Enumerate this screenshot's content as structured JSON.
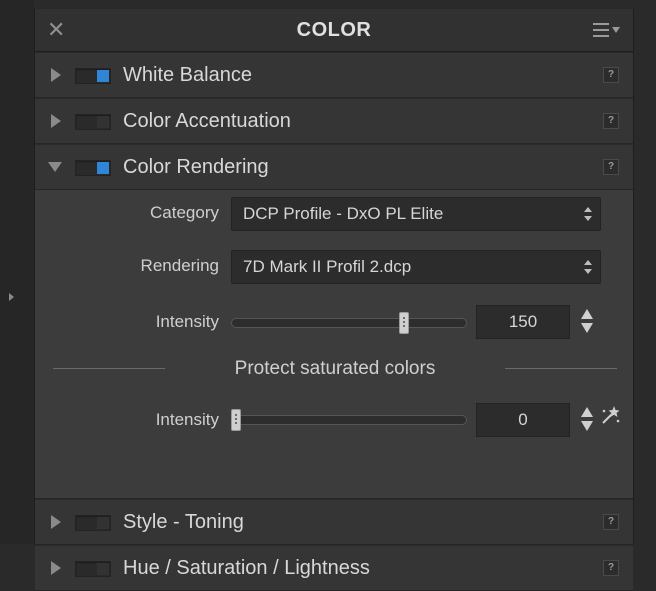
{
  "panel": {
    "title": "COLOR",
    "close_icon": "close-icon",
    "menu_icon": "menu-dropdown-icon"
  },
  "sections": [
    {
      "label": "White Balance",
      "enabled": true,
      "expanded": false
    },
    {
      "label": "Color Accentuation",
      "enabled": false,
      "expanded": false
    },
    {
      "label": "Color Rendering",
      "enabled": true,
      "expanded": true
    },
    {
      "label": "Style - Toning",
      "enabled": false,
      "expanded": false
    },
    {
      "label": "Hue / Saturation / Lightness",
      "enabled": false,
      "expanded": false
    }
  ],
  "help_label": "?",
  "color_rendering": {
    "category_label": "Category",
    "category_value": "DCP Profile - DxO PL Elite",
    "rendering_label": "Rendering",
    "rendering_value": "7D Mark II Profil 2.dcp",
    "intensity_label": "Intensity",
    "intensity_value": "150",
    "intensity_level": 0.75,
    "protect_title": "Protect saturated colors",
    "protect_intensity_label": "Intensity",
    "protect_intensity_value": "0",
    "protect_intensity_level": 0.0
  },
  "colors": {
    "accent": "#2f86d6",
    "panel_bg": "#3c3c3c",
    "header_bg": "#313131"
  }
}
